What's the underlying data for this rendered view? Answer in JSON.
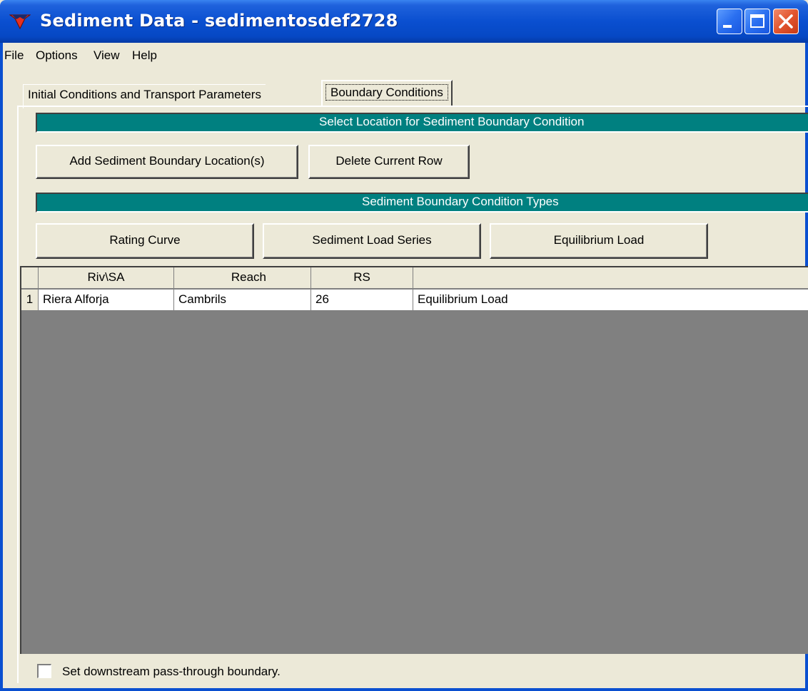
{
  "window": {
    "title": "Sediment Data - sedimentosdef2728"
  },
  "menu": [
    "File",
    "Options",
    "View",
    "Help"
  ],
  "tabs": [
    {
      "label": "Initial Conditions and Transport Parameters",
      "active": false
    },
    {
      "label": "Boundary Conditions",
      "active": true
    }
  ],
  "location_section": {
    "header": "Select Location for Sediment Boundary Condition",
    "add_button": "Add Sediment Boundary Location(s)",
    "delete_button": "Delete Current Row"
  },
  "types_section": {
    "header": "Sediment Boundary Condition Types",
    "buttons": [
      "Rating Curve",
      "Sediment Load Series",
      "Equilibrium Load"
    ]
  },
  "table": {
    "columns": [
      "Riv\\SA",
      "Reach",
      "RS",
      ""
    ],
    "rows": [
      {
        "num": "1",
        "cells": [
          "Riera Alforja",
          "Cambrils",
          "26",
          "Equilibrium Load"
        ]
      }
    ]
  },
  "passthrough": {
    "label": "Set downstream pass-through boundary.",
    "checked": false
  },
  "colors": {
    "accent_bar": "#008080",
    "grid_background": "#808080",
    "titlebar": "#0a4fd0"
  }
}
